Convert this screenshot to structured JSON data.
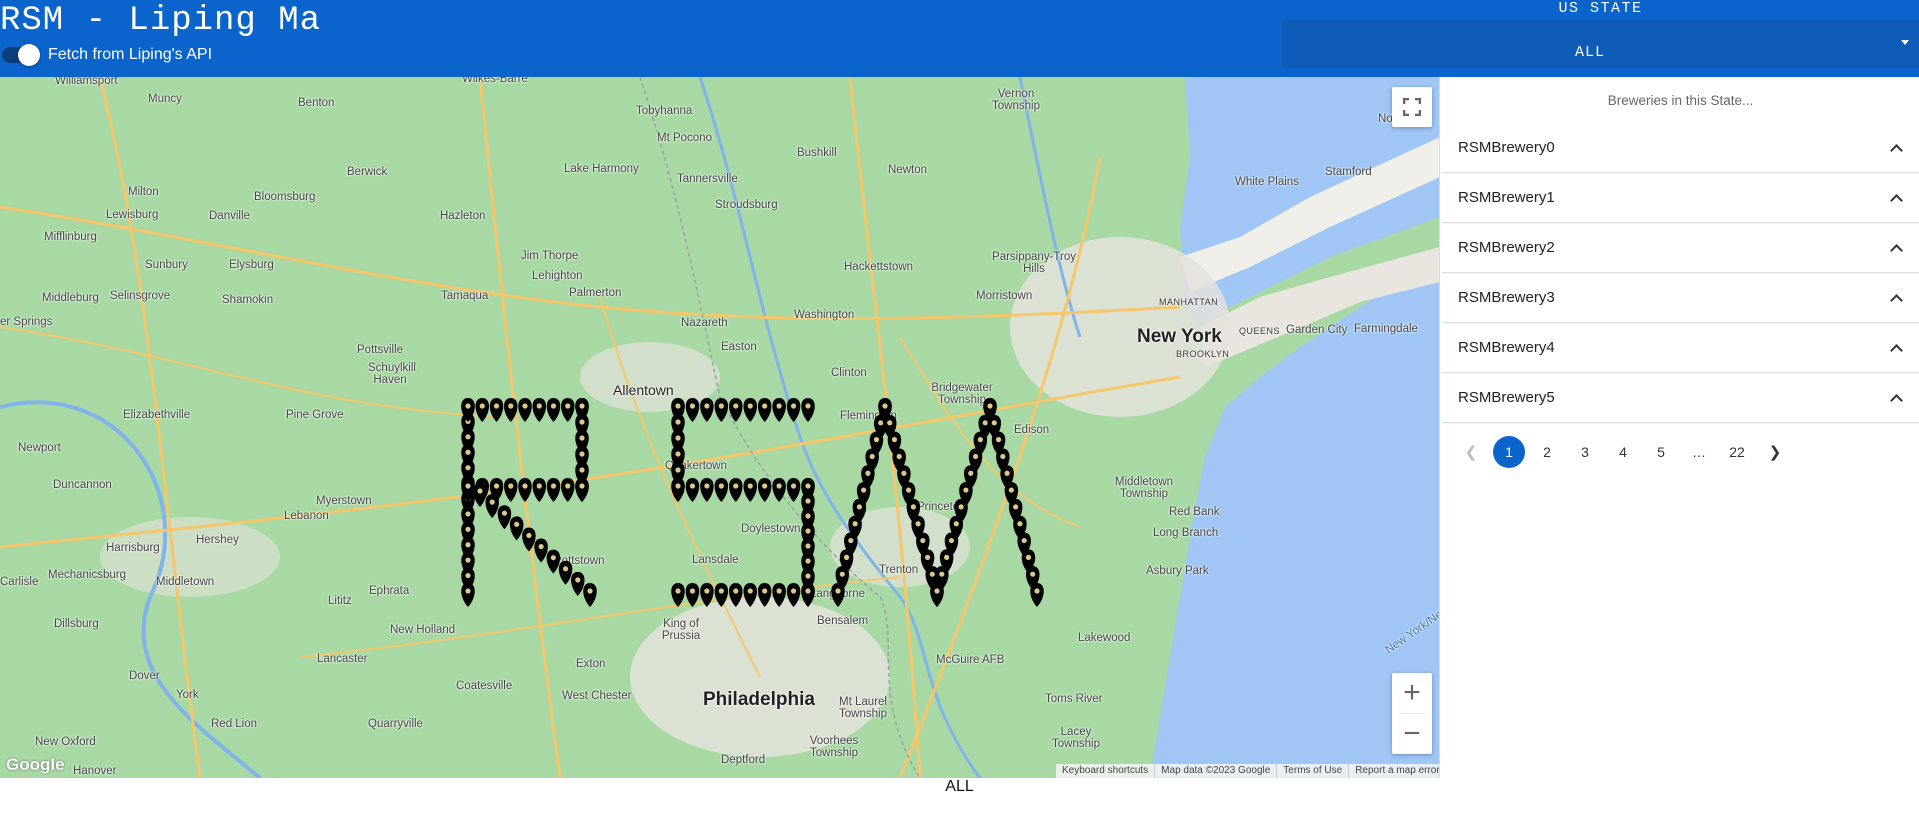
{
  "header": {
    "title": "RSM - Liping Ma",
    "toggle_label": "Fetch from Liping's API",
    "toggle_on": true
  },
  "state_filter": {
    "caption": "US STATE",
    "selected": "ALL"
  },
  "map": {
    "places": [
      {
        "name": "Williamsport",
        "cls": ""
      },
      {
        "name": "Muncy",
        "cls": ""
      },
      {
        "name": "Benton",
        "cls": ""
      },
      {
        "name": "Wilkes-Barre",
        "cls": ""
      },
      {
        "name": "Tobyhanna",
        "cls": ""
      },
      {
        "name": "Mt Pocono",
        "cls": ""
      },
      {
        "name": "Vernon Township",
        "cls": ""
      },
      {
        "name": "Milton",
        "cls": ""
      },
      {
        "name": "Berwick",
        "cls": ""
      },
      {
        "name": "Lake Harmony",
        "cls": ""
      },
      {
        "name": "Bushkill",
        "cls": ""
      },
      {
        "name": "Newton",
        "cls": ""
      },
      {
        "name": "Lewisburg",
        "cls": ""
      },
      {
        "name": "Bloomsburg",
        "cls": ""
      },
      {
        "name": "Tannersville",
        "cls": ""
      },
      {
        "name": "Stroudsburg",
        "cls": ""
      },
      {
        "name": "Norwalk",
        "cls": ""
      },
      {
        "name": "White Plains",
        "cls": ""
      },
      {
        "name": "Stamford",
        "cls": ""
      },
      {
        "name": "Mifflinburg",
        "cls": ""
      },
      {
        "name": "Danville",
        "cls": ""
      },
      {
        "name": "Hazleton",
        "cls": ""
      },
      {
        "name": "Sunbury",
        "cls": ""
      },
      {
        "name": "Elysburg",
        "cls": ""
      },
      {
        "name": "Jim Thorpe",
        "cls": ""
      },
      {
        "name": "Lehighton",
        "cls": ""
      },
      {
        "name": "Hackettstown",
        "cls": ""
      },
      {
        "name": "Parsippany-Troy Hills",
        "cls": ""
      },
      {
        "name": "Middleburg",
        "cls": ""
      },
      {
        "name": "Selinsgrove",
        "cls": ""
      },
      {
        "name": "Shamokin",
        "cls": ""
      },
      {
        "name": "Tamaqua",
        "cls": ""
      },
      {
        "name": "Palmerton",
        "cls": ""
      },
      {
        "name": "Morristown",
        "cls": ""
      },
      {
        "name": "MANHATTAN",
        "cls": "tiny"
      },
      {
        "name": "Washington",
        "cls": ""
      },
      {
        "name": "New York",
        "cls": "big"
      },
      {
        "name": "QUEENS",
        "cls": "tiny"
      },
      {
        "name": "BROOKLYN",
        "cls": "tiny"
      },
      {
        "name": "Garden City",
        "cls": ""
      },
      {
        "name": "Farmingdale",
        "cls": ""
      },
      {
        "name": "er Springs",
        "cls": ""
      },
      {
        "name": "Nazareth",
        "cls": ""
      },
      {
        "name": "Easton",
        "cls": ""
      },
      {
        "name": "Pottsville",
        "cls": ""
      },
      {
        "name": "Schuylkill Haven",
        "cls": ""
      },
      {
        "name": "Allentown",
        "cls": "mid"
      },
      {
        "name": "Clinton",
        "cls": ""
      },
      {
        "name": "Bridgewater Township",
        "cls": ""
      },
      {
        "name": "Elizabethville",
        "cls": ""
      },
      {
        "name": "Pine Grove",
        "cls": ""
      },
      {
        "name": "Edison",
        "cls": ""
      },
      {
        "name": "Newport",
        "cls": ""
      },
      {
        "name": "Quakertown",
        "cls": ""
      },
      {
        "name": "Flemington",
        "cls": ""
      },
      {
        "name": "Middletown Township",
        "cls": ""
      },
      {
        "name": "Duncannon",
        "cls": ""
      },
      {
        "name": "Myerstown",
        "cls": ""
      },
      {
        "name": "Lebanon",
        "cls": ""
      },
      {
        "name": "Princeton",
        "cls": ""
      },
      {
        "name": "Red Bank",
        "cls": ""
      },
      {
        "name": "Doylestown",
        "cls": ""
      },
      {
        "name": "Long Branch",
        "cls": ""
      },
      {
        "name": "Harrisburg",
        "cls": ""
      },
      {
        "name": "Hershey",
        "cls": ""
      },
      {
        "name": "Pottstown",
        "cls": ""
      },
      {
        "name": "Lansdale",
        "cls": ""
      },
      {
        "name": "Trenton",
        "cls": ""
      },
      {
        "name": "Asbury Park",
        "cls": ""
      },
      {
        "name": "Carlisle",
        "cls": ""
      },
      {
        "name": "Mechanicsburg",
        "cls": ""
      },
      {
        "name": "Middletown",
        "cls": ""
      },
      {
        "name": "Ephrata",
        "cls": ""
      },
      {
        "name": "Lititz",
        "cls": ""
      },
      {
        "name": "Langhorne",
        "cls": ""
      },
      {
        "name": "Dillsburg",
        "cls": ""
      },
      {
        "name": "New Holland",
        "cls": ""
      },
      {
        "name": "King of Prussia",
        "cls": ""
      },
      {
        "name": "Bensalem",
        "cls": ""
      },
      {
        "name": "Lakewood",
        "cls": ""
      },
      {
        "name": "Lancaster",
        "cls": ""
      },
      {
        "name": "Exton",
        "cls": ""
      },
      {
        "name": "McGuire AFB",
        "cls": ""
      },
      {
        "name": "Dover",
        "cls": ""
      },
      {
        "name": "York",
        "cls": ""
      },
      {
        "name": "Coatesville",
        "cls": ""
      },
      {
        "name": "West Chester",
        "cls": ""
      },
      {
        "name": "Philadelphia",
        "cls": "big"
      },
      {
        "name": "Toms River",
        "cls": ""
      },
      {
        "name": "Red Lion",
        "cls": ""
      },
      {
        "name": "Quarryville",
        "cls": ""
      },
      {
        "name": "Mt Laurel Township",
        "cls": ""
      },
      {
        "name": "New Oxford",
        "cls": ""
      },
      {
        "name": "Voorhees Township",
        "cls": ""
      },
      {
        "name": "Lacey Township",
        "cls": ""
      },
      {
        "name": "Hanover",
        "cls": ""
      },
      {
        "name": "Deptford",
        "cls": ""
      },
      {
        "name": "New York/New",
        "cls": ""
      }
    ],
    "google_logo": "Google",
    "attribution": [
      "Keyboard shortcuts",
      "Map data ©2023 Google",
      "Terms of Use",
      "Report a map error"
    ],
    "zoom_in_label": "+",
    "zoom_out_label": "−",
    "fullscreen_icon": "fullscreen-icon"
  },
  "bottom_state_label": "ALL",
  "sidebar": {
    "heading": "Breweries in this State...",
    "breweries": [
      "RSMBrewery0",
      "RSMBrewery1",
      "RSMBrewery2",
      "RSMBrewery3",
      "RSMBrewery4",
      "RSMBrewery5"
    ],
    "pagination": {
      "pages": [
        "1",
        "2",
        "3",
        "4",
        "5",
        "…",
        "22"
      ],
      "current": "1"
    }
  },
  "colors": {
    "header_bg": "#0a64cc",
    "select_bg": "#0f5bb8",
    "map_land": "#a8d9a4",
    "map_water": "#9fc6f5",
    "marker": "#000000"
  }
}
